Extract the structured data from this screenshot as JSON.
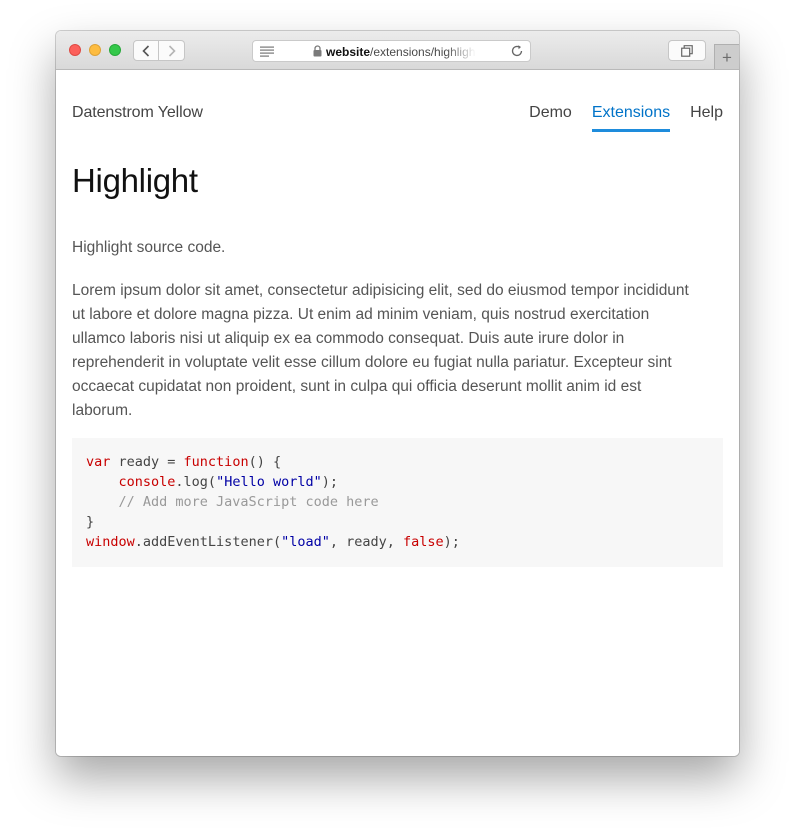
{
  "browser": {
    "url_host": "website",
    "url_path": "/extensions/highlight"
  },
  "header": {
    "site_name": "Datenstrom Yellow",
    "menu": [
      {
        "label": "Demo",
        "active": false
      },
      {
        "label": "Extensions",
        "active": true
      },
      {
        "label": "Help",
        "active": false
      }
    ]
  },
  "main": {
    "title": "Highlight",
    "intro": "Highlight source code.",
    "body": "Lorem ipsum dolor sit amet, consectetur adipisicing elit, sed do eiusmod tempor incididunt ut labore et dolore magna pizza. Ut enim ad minim veniam, quis nostrud exercitation ullamco laboris nisi ut aliquip ex ea commodo consequat. Duis aute irure dolor in reprehenderit in voluptate velit esse cillum dolore eu fugiat nulla pariatur. Excepteur sint occaecat cupidatat non proident, sunt in culpa qui officia deserunt mollit anim id est laborum.",
    "code": {
      "l1_kw": "var",
      "l1_rest1": " ready = ",
      "l1_fn": "function",
      "l1_rest2": "() {",
      "l2_indent": "    ",
      "l2_obj": "console",
      "l2_mid": ".log(",
      "l2_str": "\"Hello world\"",
      "l2_end": ");",
      "l3_comment": "    // Add more JavaScript code here",
      "l4": "}",
      "l5_obj": "window",
      "l5_mid": ".addEventListener(",
      "l5_str": "\"load\"",
      "l5_mid2": ", ready, ",
      "l5_kw": "false",
      "l5_end": ");"
    }
  },
  "colors": {
    "accent": "#1e8cdc",
    "keyword": "#c80000",
    "string": "#0000a5",
    "comment": "#999999"
  }
}
